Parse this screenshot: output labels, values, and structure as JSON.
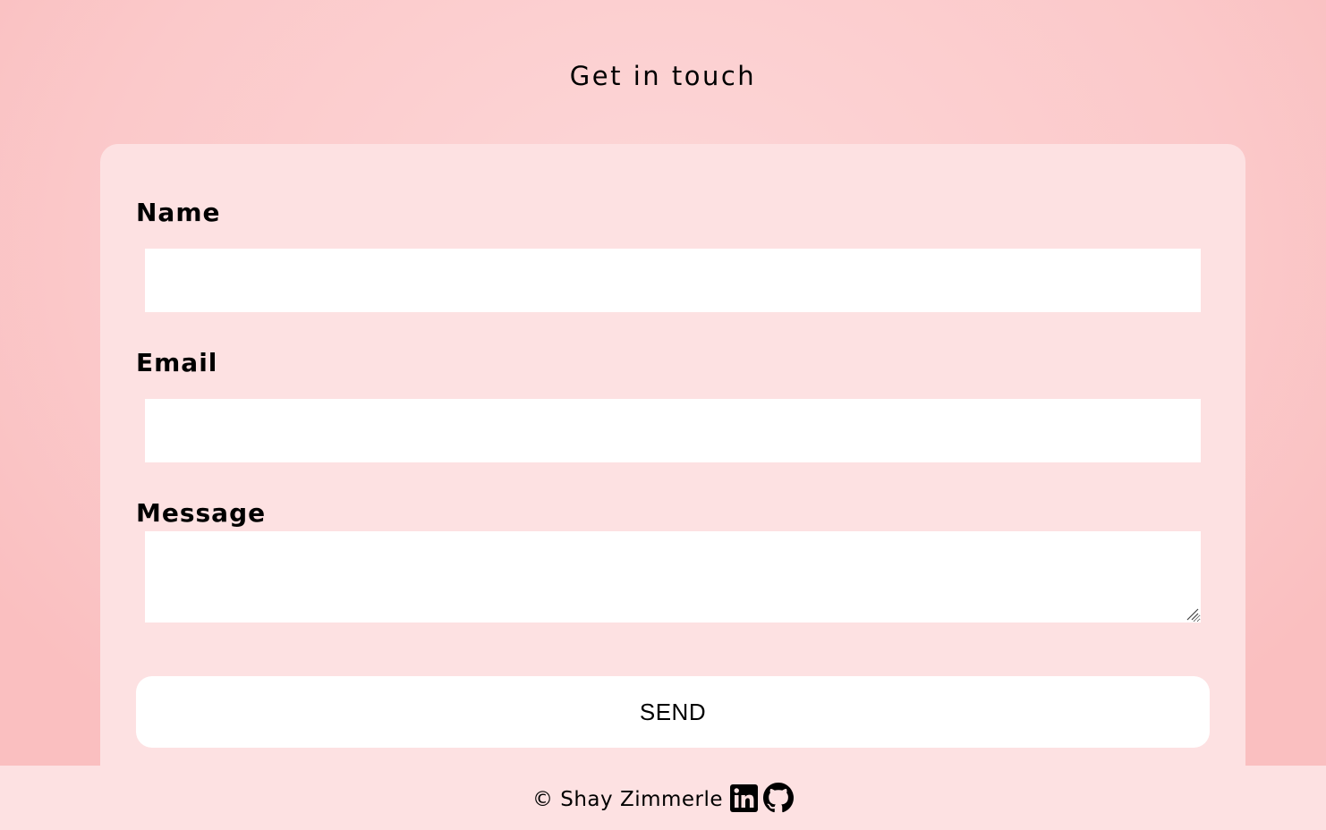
{
  "header": {
    "title": "Get in touch"
  },
  "form": {
    "name_label": "Name",
    "name_value": "",
    "email_label": "Email",
    "email_value": "",
    "message_label": "Message",
    "message_value": "",
    "send_label": "SEND"
  },
  "footer": {
    "copyright": "© Shay Zimmerle",
    "icons": [
      "linkedin-icon",
      "github-icon"
    ]
  },
  "colors": {
    "background": "#fbc9ca",
    "card": "#fde1e2",
    "input": "#ffffff",
    "text": "#000000"
  }
}
